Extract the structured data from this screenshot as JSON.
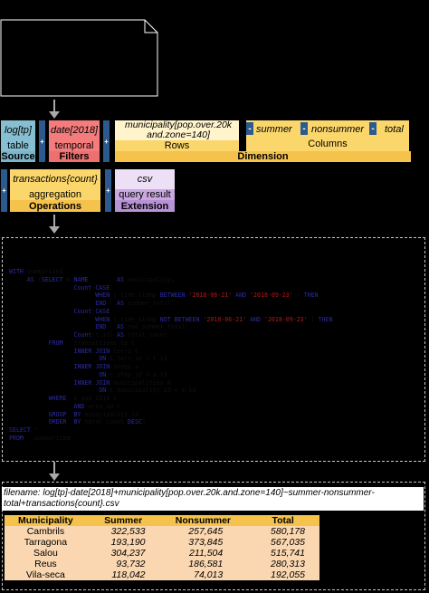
{
  "colors": {
    "source": "#86bfd1",
    "filters": "#f47c7c",
    "dimension": "#fbd76b",
    "operations": "#fbd76b",
    "extension": "#c9a8e0",
    "separator": "#2d5a8e",
    "table_header": "#f5c24c",
    "table_row": "#fad7b0"
  },
  "icons": {
    "note": "document-note-icon",
    "arrow": "down-arrow-icon"
  },
  "pipeline": {
    "source": {
      "top": "log[tp]",
      "mid": "table",
      "bottom": "Source"
    },
    "filters": {
      "top": "date[2018]",
      "mid": "temporal",
      "bottom": "Filters"
    },
    "dimension": {
      "rows_param": "municipality[pop.over.20k and.zone=140]",
      "rows_label": "Rows",
      "summer": "summer",
      "nonsummer": "nonsummer",
      "total": "total",
      "columns_label": "Columns",
      "bottom": "Dimension"
    },
    "operations": {
      "top": "transactions{count}",
      "mid": "aggregation",
      "bottom": "Operations"
    },
    "extension": {
      "top": "csv",
      "mid": "query result",
      "bottom": "Extension"
    },
    "plus": "+",
    "minus": "-"
  },
  "sql_lines": [
    [
      [
        "k",
        "WITH"
      ],
      [
        "t",
        " summarized"
      ]
    ],
    [
      [
        "t",
        "     "
      ],
      [
        "k",
        "AS"
      ],
      [
        "t",
        " ("
      ],
      [
        "k",
        "SELECT"
      ],
      [
        "t",
        " m."
      ],
      [
        "k",
        "NAME"
      ],
      [
        "t",
        "        "
      ],
      [
        "k",
        "AS"
      ],
      [
        "t",
        " municipality,"
      ]
    ],
    [
      [
        "t",
        "                  "
      ],
      [
        "k",
        "Count"
      ],
      [
        "t",
        "("
      ],
      [
        "k",
        "CASE"
      ]
    ],
    [
      [
        "t",
        "                        "
      ],
      [
        "k",
        "WHEN"
      ],
      [
        "t",
        " ( time_stamp "
      ],
      [
        "k",
        "BETWEEN"
      ],
      [
        "t",
        " "
      ],
      [
        "s",
        "'2018-06-21'"
      ],
      [
        "t",
        " "
      ],
      [
        "k",
        "AND"
      ],
      [
        "t",
        " "
      ],
      [
        "s",
        "'2018-09-23'"
      ],
      [
        "t",
        " ) "
      ],
      [
        "k",
        "THEN"
      ]
    ],
    [
      [
        "t",
        "                        "
      ],
      [
        "k",
        "END"
      ],
      [
        "t",
        "   "
      ],
      [
        "k",
        "AS"
      ],
      [
        "t",
        " summer_total,"
      ]
    ],
    [
      [
        "t",
        "                  "
      ],
      [
        "k",
        "Count"
      ],
      [
        "t",
        "("
      ],
      [
        "k",
        "CASE"
      ]
    ],
    [
      [
        "t",
        "                        "
      ],
      [
        "k",
        "WHEN"
      ],
      [
        "t",
        " ( time_stamp "
      ],
      [
        "k",
        "NOT"
      ],
      [
        "t",
        " "
      ],
      [
        "k",
        "BETWEEN"
      ],
      [
        "t",
        " "
      ],
      [
        "s",
        "'2018-06-21'"
      ],
      [
        "t",
        " "
      ],
      [
        "k",
        "AND"
      ],
      [
        "t",
        " "
      ],
      [
        "s",
        "'2018-09-23'"
      ],
      [
        "t",
        " ) "
      ],
      [
        "k",
        "THEN"
      ]
    ],
    [
      [
        "t",
        "                        "
      ],
      [
        "k",
        "END"
      ],
      [
        "t",
        "   "
      ],
      [
        "k",
        "AS"
      ],
      [
        "t",
        " non_summer_total,"
      ]
    ],
    [
      [
        "t",
        "                  "
      ],
      [
        "k",
        "Count"
      ],
      [
        "t",
        "(t.id) "
      ],
      [
        "k",
        "AS"
      ],
      [
        "t",
        " total_count"
      ]
    ],
    [
      [
        "t",
        "           "
      ],
      [
        "k",
        "FROM"
      ],
      [
        "t",
        "   transactions_tp t"
      ]
    ],
    [
      [
        "t",
        "                  "
      ],
      [
        "k",
        "INNER"
      ],
      [
        "t",
        " "
      ],
      [
        "k",
        "JOIN"
      ],
      [
        "t",
        " terrs t"
      ]
    ],
    [
      [
        "t",
        "                         "
      ],
      [
        "k",
        "ON"
      ],
      [
        "t",
        " t.terr_id = t.id"
      ]
    ],
    [
      [
        "t",
        "                  "
      ],
      [
        "k",
        "INNER"
      ],
      [
        "t",
        " "
      ],
      [
        "k",
        "JOIN"
      ],
      [
        "t",
        " stops s"
      ]
    ],
    [
      [
        "t",
        "                         "
      ],
      [
        "k",
        "ON"
      ],
      [
        "t",
        " s.stop_id = s.id"
      ]
    ],
    [
      [
        "t",
        "                  "
      ],
      [
        "k",
        "INNER"
      ],
      [
        "t",
        " "
      ],
      [
        "k",
        "JOIN"
      ],
      [
        "t",
        " municipalities m"
      ]
    ],
    [
      [
        "t",
        "                         "
      ],
      [
        "k",
        "ON"
      ],
      [
        "t",
        " s.municipality_id = m.id"
      ]
    ],
    [
      [
        "t",
        "           "
      ],
      [
        "k",
        "WHERE"
      ],
      [
        "t",
        "  m.pop_2018 > "
      ]
    ],
    [
      [
        "t",
        "                  "
      ],
      [
        "k",
        "AND"
      ],
      [
        "t",
        " area_id = "
      ]
    ],
    [
      [
        "t",
        "           "
      ],
      [
        "k",
        "GROUP"
      ],
      [
        "t",
        "  "
      ],
      [
        "k",
        "BY"
      ],
      [
        "t",
        " municipality_id"
      ]
    ],
    [
      [
        "t",
        "           "
      ],
      [
        "k",
        "ORDER"
      ],
      [
        "t",
        "  "
      ],
      [
        "k",
        "BY"
      ],
      [
        "t",
        " total_count "
      ],
      [
        "k",
        "DESC"
      ],
      [
        "t",
        ")"
      ]
    ],
    [
      [
        "k",
        "SELECT"
      ],
      [
        "t",
        " *"
      ]
    ],
    [
      [
        "k",
        "FROM"
      ],
      [
        "t",
        "   summarized;"
      ]
    ]
  ],
  "result": {
    "filename": "filename: log[tp]-date[2018]+municipality[pop.over.20k.and.zone=140]~summer-nonsummer-total+transactions{count}.csv",
    "headers": [
      "Municipality",
      "Summer",
      "Nonsummer",
      "Total"
    ],
    "rows": [
      [
        "Cambrils",
        "322,533",
        "257,645",
        "580,178"
      ],
      [
        "Tarragona",
        "193,190",
        "373,845",
        "567,035"
      ],
      [
        "Salou",
        "304,237",
        "211,504",
        "515,741"
      ],
      [
        "Reus",
        "93,732",
        "186,581",
        "280,313"
      ],
      [
        "Vila-seca",
        "118,042",
        "74,013",
        "192,055"
      ]
    ]
  }
}
